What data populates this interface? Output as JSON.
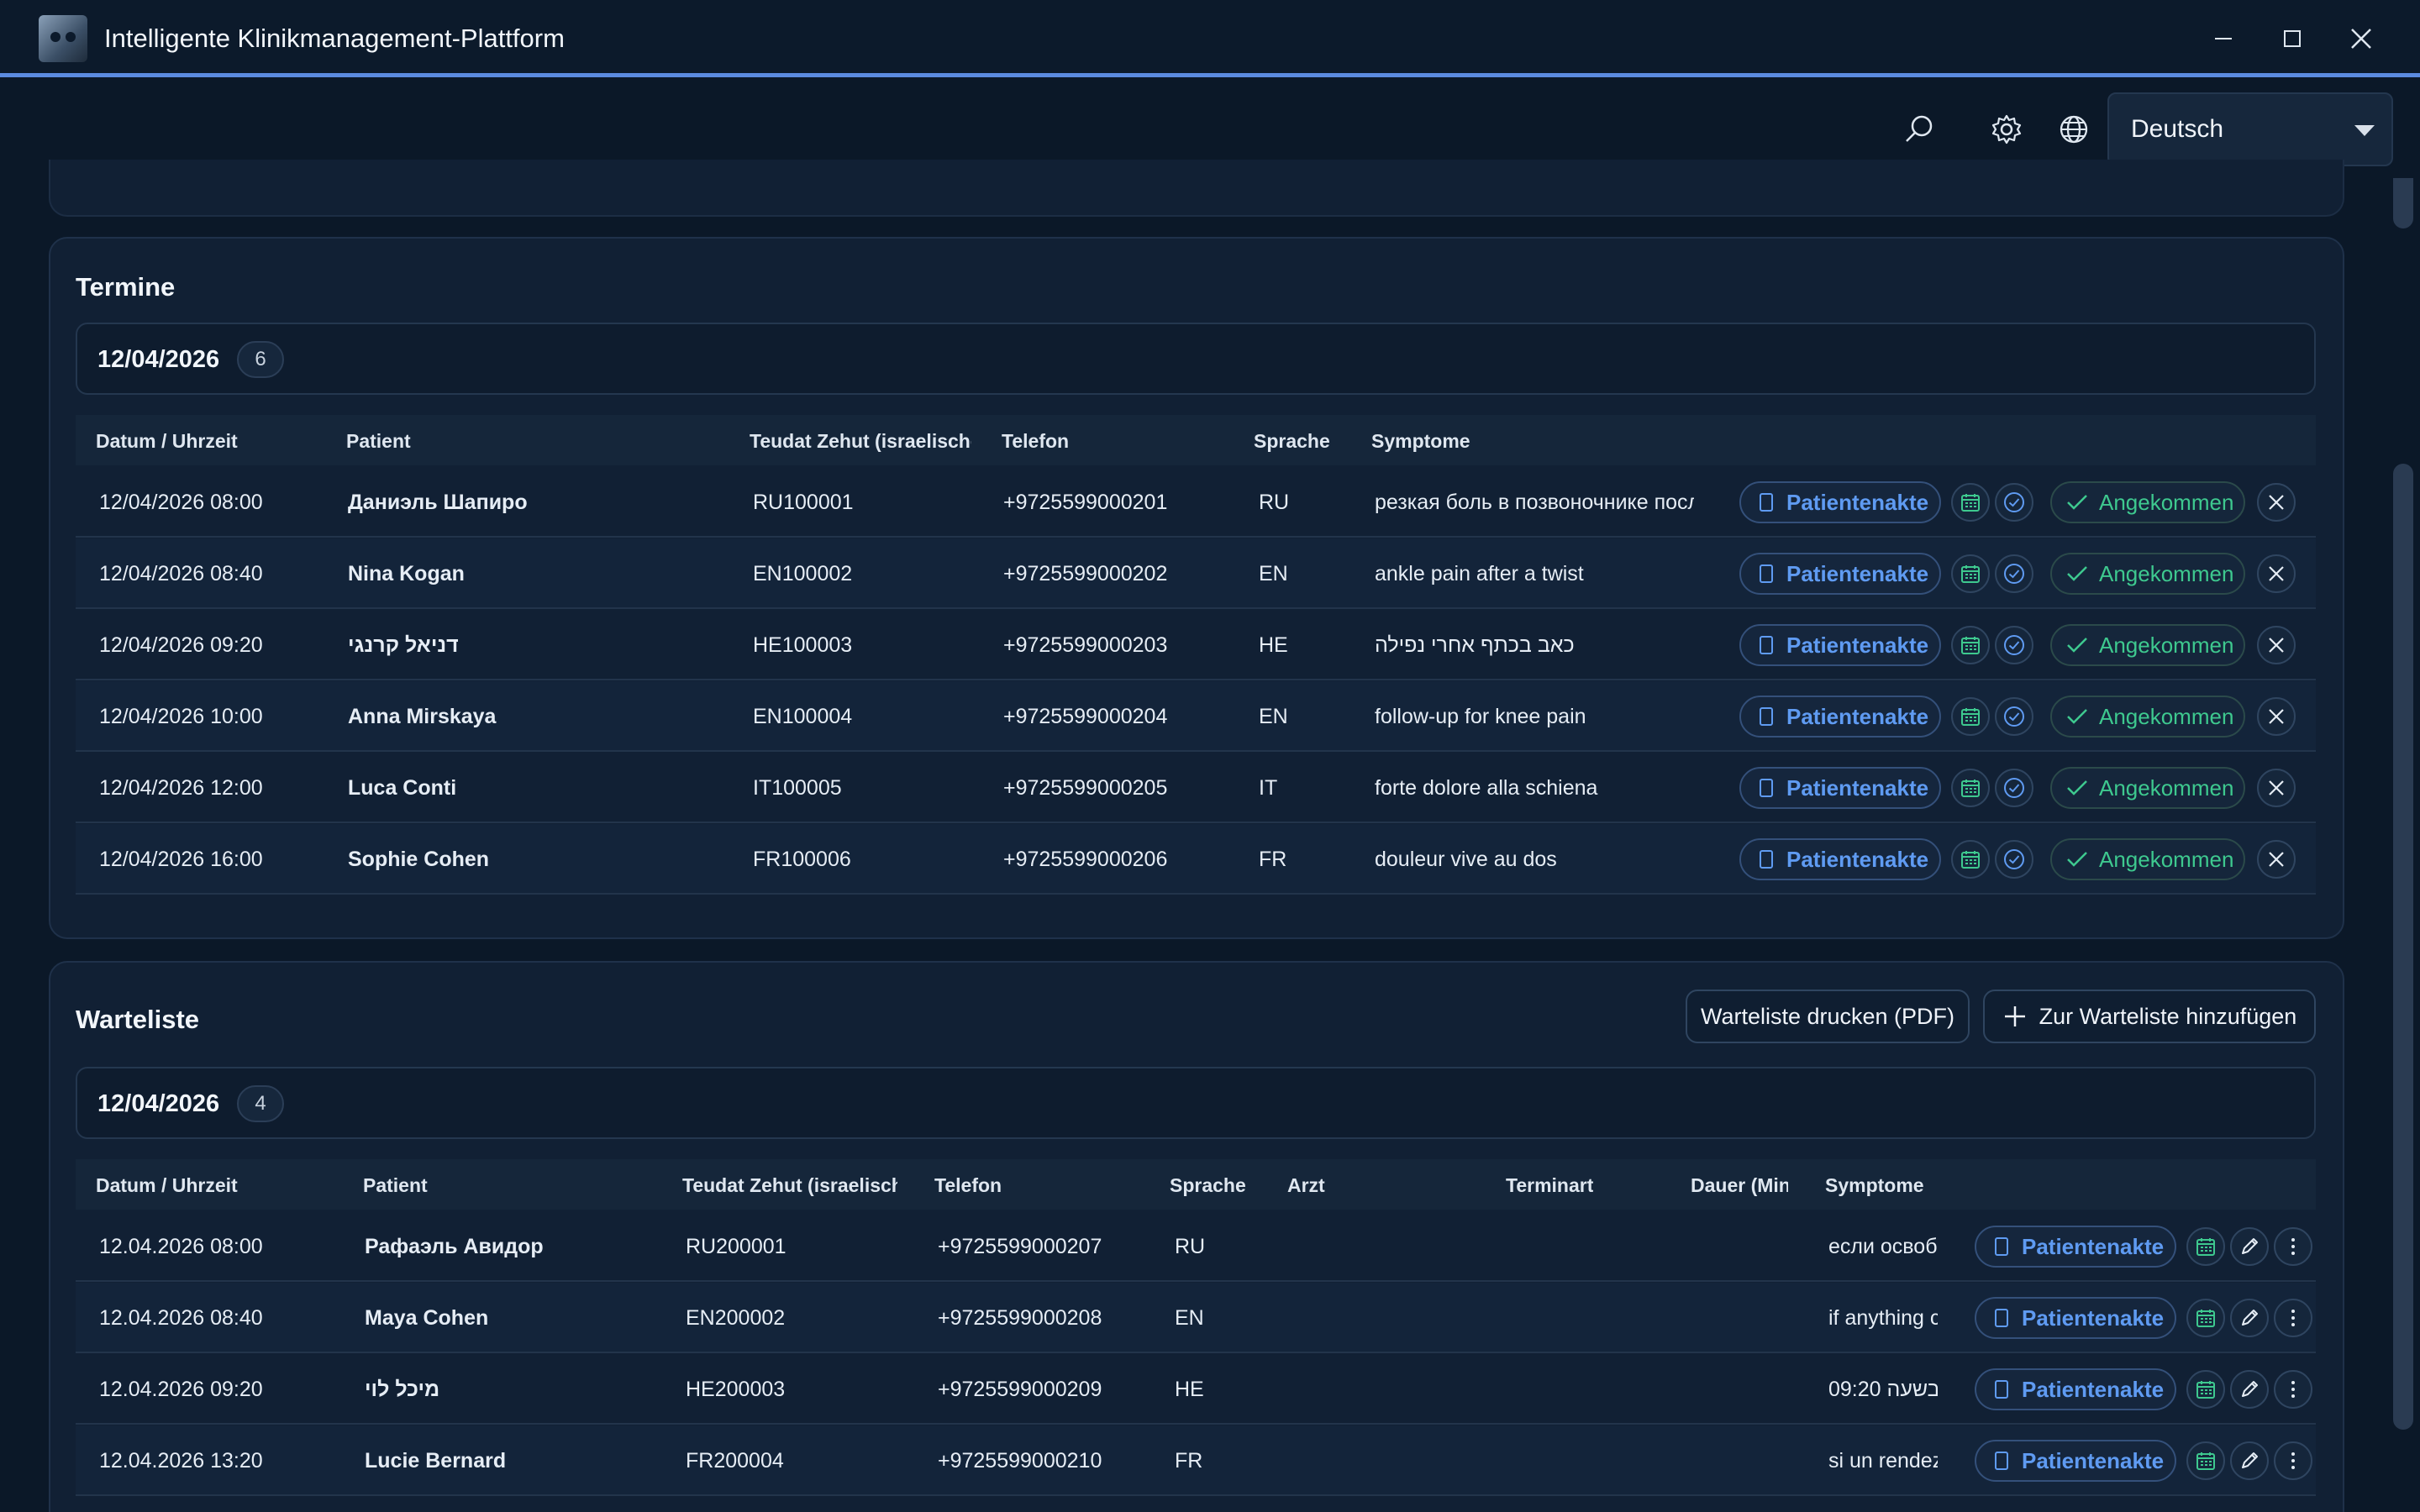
{
  "window": {
    "title": "Intelligente Klinikmanagement-Plattform"
  },
  "toolbar": {
    "language": "Deutsch",
    "icons": [
      "search-icon",
      "gear-icon",
      "globe-icon"
    ]
  },
  "appointments": {
    "title": "Termine",
    "date": "12/04/2026",
    "count": "6",
    "columns": [
      "Datum / Uhrzeit",
      "Patient",
      "Teudat Zehut (israelische",
      "Telefon",
      "Sprache",
      "Symptome"
    ],
    "actions": {
      "record": "Patientenakte",
      "arrived": "Angekommen"
    },
    "rows": [
      {
        "datetime": "12/04/2026 08:00",
        "patient": "Даниэль Шапиро",
        "id": "RU100001",
        "phone": "+9725599000201",
        "lang": "RU",
        "symptoms": "резкая боль в позвоночнике после"
      },
      {
        "datetime": "12/04/2026 08:40",
        "patient": "Nina Kogan",
        "id": "EN100002",
        "phone": "+9725599000202",
        "lang": "EN",
        "symptoms": "ankle pain after a twist"
      },
      {
        "datetime": "12/04/2026 09:20",
        "patient": "דניאל קרנגי",
        "id": "HE100003",
        "phone": "+9725599000203",
        "lang": "HE",
        "symptoms": "כאב בכתף אחרי נפילה"
      },
      {
        "datetime": "12/04/2026 10:00",
        "patient": "Anna Mirskaya",
        "id": "EN100004",
        "phone": "+9725599000204",
        "lang": "EN",
        "symptoms": "follow-up for knee pain"
      },
      {
        "datetime": "12/04/2026 12:00",
        "patient": "Luca Conti",
        "id": "IT100005",
        "phone": "+9725599000205",
        "lang": "IT",
        "symptoms": "forte dolore alla schiena"
      },
      {
        "datetime": "12/04/2026 16:00",
        "patient": "Sophie Cohen",
        "id": "FR100006",
        "phone": "+9725599000206",
        "lang": "FR",
        "symptoms": "douleur vive au dos"
      }
    ]
  },
  "waitlist": {
    "title": "Warteliste",
    "print_label": "Warteliste drucken (PDF)",
    "add_label": "Zur Warteliste hinzufügen",
    "date": "12/04/2026",
    "count": "4",
    "columns": [
      "Datum / Uhrzeit",
      "Patient",
      "Teudat Zehut (israelische",
      "Telefon",
      "Sprache",
      "Arzt",
      "Terminart",
      "Dauer (Min",
      "Symptome"
    ],
    "actions": {
      "record": "Patientenakte"
    },
    "rows": [
      {
        "datetime": "12.04.2026 08:00",
        "patient": "Рафаэль Авидор",
        "id": "RU200001",
        "phone": "+9725599000207",
        "lang": "RU",
        "doctor": "",
        "type": "",
        "duration": "",
        "symptoms": "если освобо"
      },
      {
        "datetime": "12.04.2026 08:40",
        "patient": "Maya Cohen",
        "id": "EN200002",
        "phone": "+9725599000208",
        "lang": "EN",
        "doctor": "",
        "type": "",
        "duration": "",
        "symptoms": "if anything c"
      },
      {
        "datetime": "12.04.2026 09:20",
        "patient": "מיכל לוי",
        "id": "HE200003",
        "phone": "+9725599000209",
        "lang": "HE",
        "doctor": "",
        "type": "",
        "duration": "",
        "symptoms": "09:20 בשעה"
      },
      {
        "datetime": "12.04.2026 13:20",
        "patient": "Lucie Bernard",
        "id": "FR200004",
        "phone": "+9725599000210",
        "lang": "FR",
        "doctor": "",
        "type": "",
        "duration": "",
        "symptoms": "si un rendez"
      }
    ]
  }
}
